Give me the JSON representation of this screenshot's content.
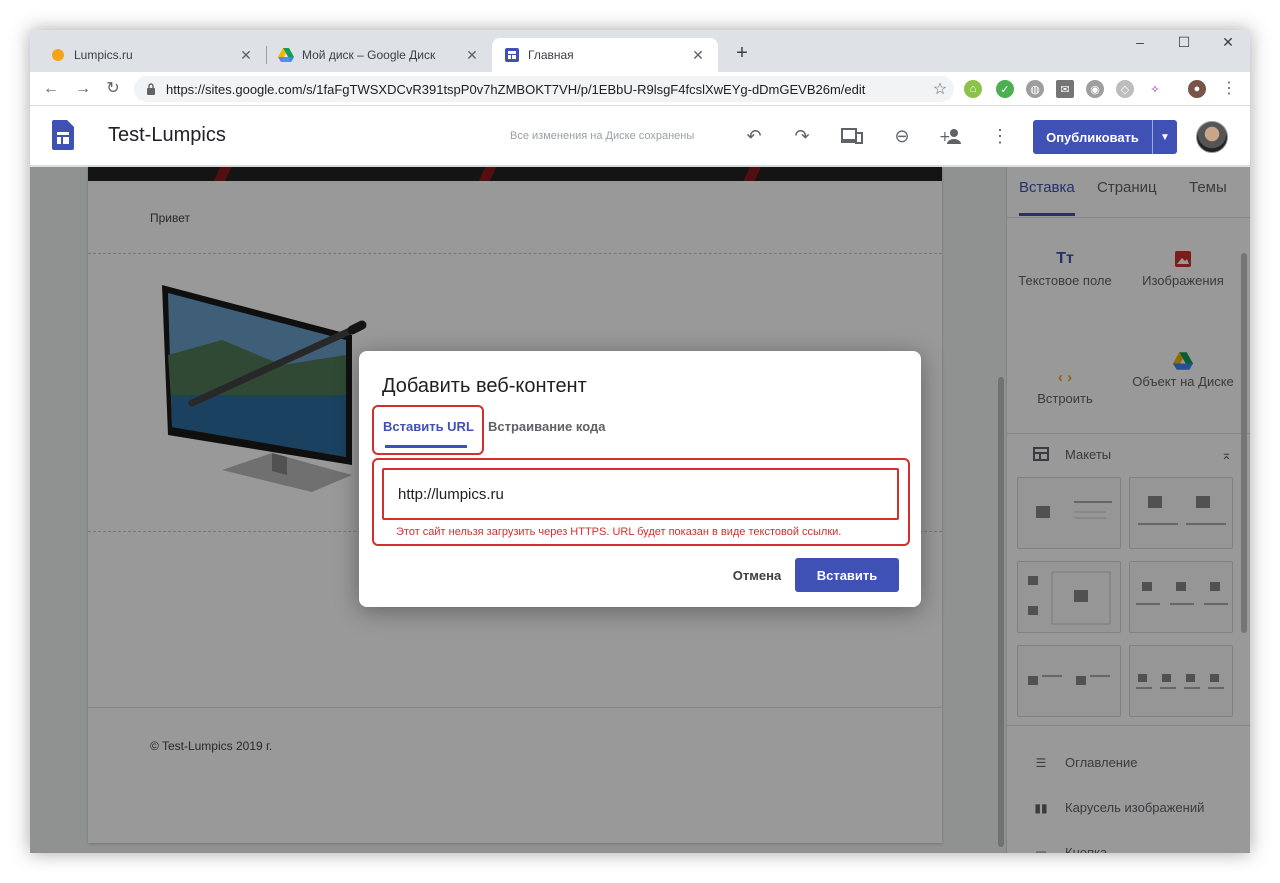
{
  "browser": {
    "tabs": [
      {
        "title": "Lumpics.ru",
        "icon": "lumpics-favicon"
      },
      {
        "title": "Мой диск – Google Диск",
        "icon": "google-drive-favicon"
      },
      {
        "title": "Главная",
        "icon": "google-sites-favicon",
        "active": true
      }
    ],
    "url": "https://sites.google.com/s/1faFgTWSXDCvR391tspP0v7hZMBOKT7VH/p/1EBbU-R9lsgF4fcslXwEYg-dDmGEVB26m/edit"
  },
  "sites_header": {
    "title": "Test-Lumpics",
    "saved_message": "Все изменения на Диске сохранены",
    "publish_label": "Опубликовать"
  },
  "page": {
    "greeting": "Привет",
    "footer": "© Test-Lumpics 2019 г."
  },
  "right_panel": {
    "tabs": [
      "Вставка",
      "Страниц",
      "Темы"
    ],
    "insert_items": [
      {
        "label": "Текстовое поле",
        "icon": "text-box-icon"
      },
      {
        "label": "Изображения",
        "icon": "image-icon"
      },
      {
        "label": "Встроить",
        "icon": "embed-icon"
      },
      {
        "label": "Объект на Диске",
        "icon": "drive-icon"
      }
    ],
    "layouts_label": "Макеты",
    "list_items": [
      {
        "label": "Оглавление",
        "icon": "toc-icon"
      },
      {
        "label": "Карусель изображений",
        "icon": "carousel-icon"
      },
      {
        "label": "Кнопка",
        "icon": "button-icon"
      }
    ]
  },
  "dialog": {
    "title": "Добавить веб-контент",
    "tab_url": "Вставить URL",
    "tab_code": "Встраивание кода",
    "url_value": "http://lumpics.ru",
    "error": "Этот сайт нельзя загрузить через HTTPS. URL будет показан в виде текстовой ссылки.",
    "cancel_label": "Отмена",
    "insert_label": "Вставить"
  },
  "colors": {
    "accent": "#3f51b5",
    "error": "#d32f2f"
  }
}
